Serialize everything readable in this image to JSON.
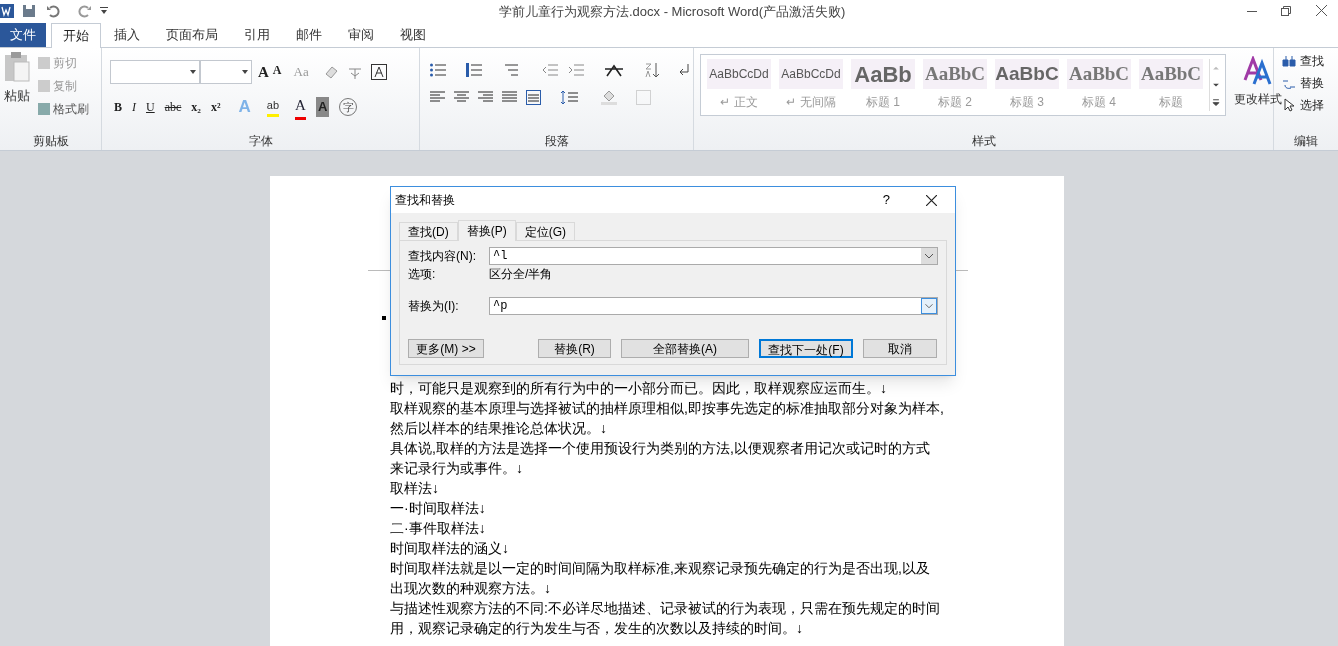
{
  "window": {
    "title": "学前儿童行为观察方法.docx  -  Microsoft Word(产品激活失败)"
  },
  "tabs": [
    {
      "label": "文件",
      "kind": "file",
      "selected": false
    },
    {
      "label": "开始",
      "kind": "tab",
      "selected": true
    },
    {
      "label": "插入",
      "kind": "tab",
      "selected": false
    },
    {
      "label": "页面布局",
      "kind": "tab",
      "selected": false
    },
    {
      "label": "引用",
      "kind": "tab",
      "selected": false
    },
    {
      "label": "邮件",
      "kind": "tab",
      "selected": false
    },
    {
      "label": "审阅",
      "kind": "tab",
      "selected": false
    },
    {
      "label": "视图",
      "kind": "tab",
      "selected": false
    }
  ],
  "clipboard": {
    "label": "剪贴板",
    "paste": "粘贴",
    "items": [
      {
        "label": "剪切",
        "disabled": true
      },
      {
        "label": "复制",
        "disabled": true
      },
      {
        "label": "格式刷",
        "disabled": false
      }
    ]
  },
  "font": {
    "label": "字体",
    "size_buttons": [
      "A",
      "A"
    ],
    "case_button": "Aa",
    "format_buttons": [
      "B",
      "I",
      "U",
      "abc",
      "x₂",
      "x²"
    ],
    "color_buttons": [
      "A",
      "ab",
      "A",
      "A",
      "字"
    ]
  },
  "paragraph": {
    "label": "段落"
  },
  "styles": {
    "label": "样式",
    "items": [
      {
        "preview": "AaBbCcDd",
        "name": "↵ 正文",
        "kind": "small"
      },
      {
        "preview": "AaBbCcDd",
        "name": "↵ 无间隔",
        "kind": "small"
      },
      {
        "preview": "AaBb",
        "name": "标题 1",
        "kind": "h1"
      },
      {
        "preview": "AaBbC",
        "name": "标题 2",
        "kind": "h2"
      },
      {
        "preview": "AaBbC",
        "name": "标题 3",
        "kind": "h3"
      },
      {
        "preview": "AaBbC",
        "name": "标题 4",
        "kind": "h2"
      },
      {
        "preview": "AaBbC",
        "name": "标题",
        "kind": "h2"
      }
    ],
    "change": "更改样式"
  },
  "editing": {
    "label": "编辑",
    "items": [
      {
        "label": "查找",
        "kind": "find"
      },
      {
        "label": "替换",
        "kind": "replace"
      },
      {
        "label": "选择",
        "kind": "select"
      }
    ]
  },
  "dialog": {
    "title": "查找和替换",
    "help": "?",
    "tabs": [
      {
        "label": "查找(D)",
        "selected": false
      },
      {
        "label": "替换(P)",
        "selected": true
      },
      {
        "label": "定位(G)",
        "selected": false
      }
    ],
    "find_label": "查找内容(N):",
    "find_value": "^l",
    "options_label": "选项:",
    "options_value": "区分全/半角",
    "replace_label": "替换为(I):",
    "replace_value": "^p",
    "buttons": [
      {
        "label": "更多(M) >>",
        "default": false
      },
      {
        "label": "替换(R)",
        "default": false
      },
      {
        "label": "全部替换(A)",
        "default": false
      },
      {
        "label": "查找下一处(F)",
        "default": true
      },
      {
        "label": "取消",
        "default": false
      }
    ]
  },
  "document": {
    "lines": [
      "时，可能只是观察到的所有行为中的一小部分而已。因此，取样观察应运而生。↓",
      "取样观察的基本原理与选择被试的抽样原理相似,即按事先选定的标准抽取部分对象为样本,",
      "然后以样本的结果推论总体状况。↓",
      "具体说,取样的方法是选择一个使用预设行为类别的方法,以便观察者用记次或记时的方式",
      "来记录行为或事件。↓",
      "取样法↓",
      "一·时间取样法↓",
      "二·事件取样法↓",
      "时间取样法的涵义↓",
      "时间取样法就是以一定的时间间隔为取样标准,来观察记录预先确定的行为是否出现,以及",
      "出现次数的种观察方法。↓",
      "与描述性观察方法的不同:不必详尽地描述、记录被试的行为表现，只需在预先规定的时间",
      "用，观察记录确定的行为发生与否，发生的次数以及持续的时间。↓"
    ]
  }
}
